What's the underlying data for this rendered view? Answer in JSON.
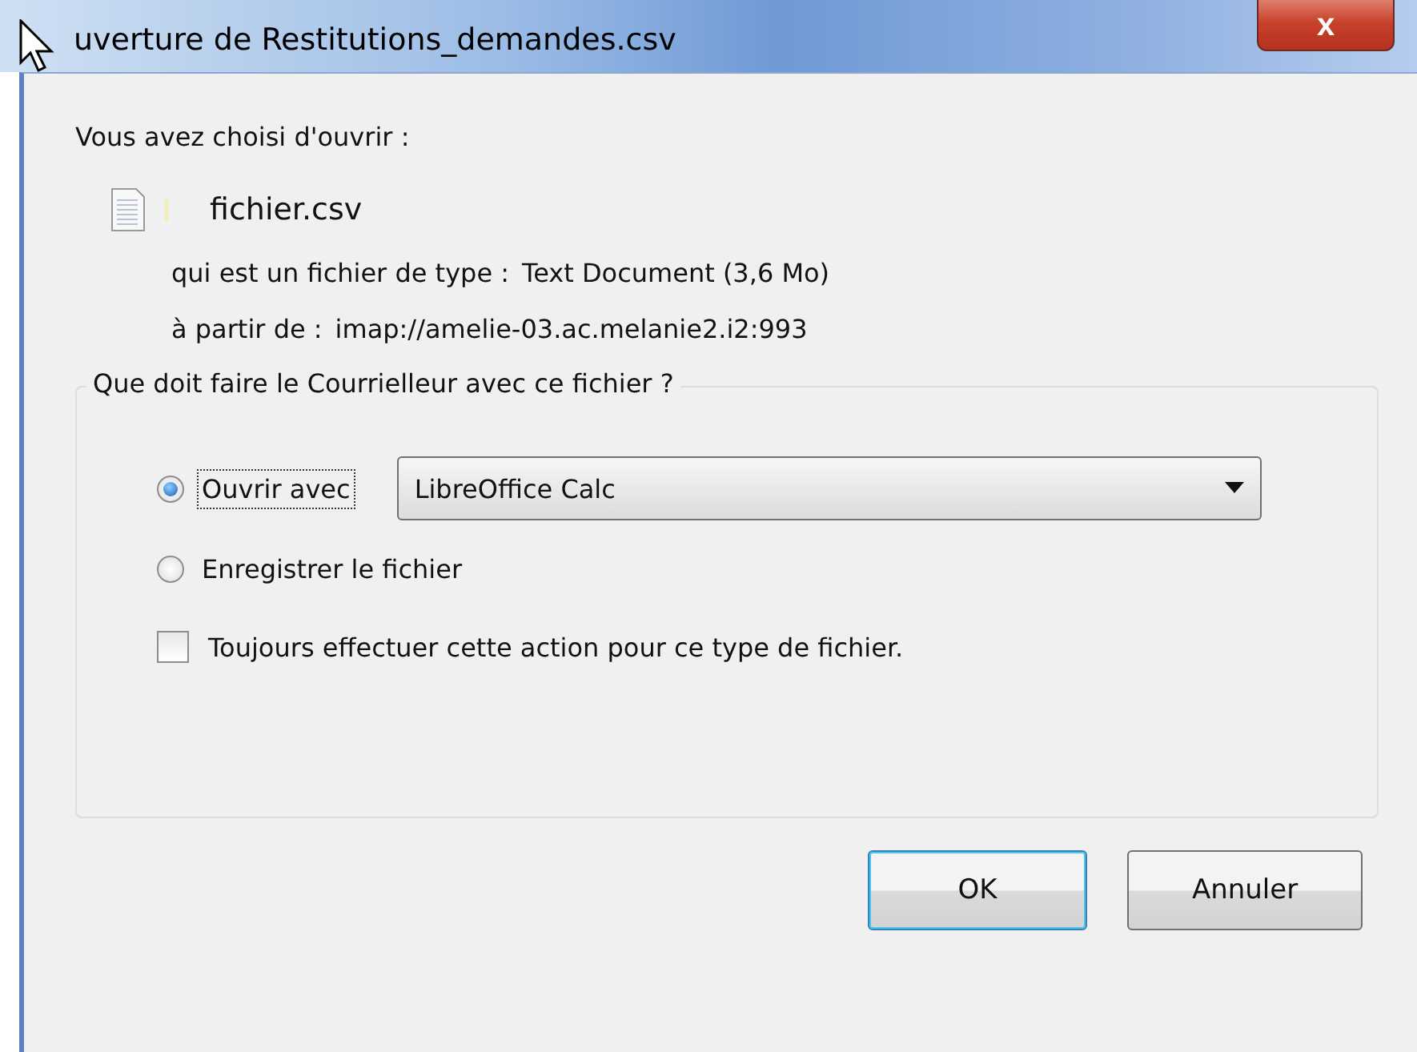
{
  "window": {
    "title": "uverture de Restitutions_demandes.csv",
    "close_label": "x"
  },
  "intro": "Vous avez choisi d'ouvrir :",
  "file": {
    "name": "fichier.csv",
    "type_label": "qui est un fichier de type :",
    "type_value": "Text Document (3,6 Mo)",
    "from_label": "à partir de :",
    "from_value": "imap://amelie-03.ac.melanie2.i2:993"
  },
  "group": {
    "title": "Que doit faire le Courrielleur avec ce fichier ?",
    "options": [
      {
        "label": "Ouvrir avec",
        "selected": true,
        "focused": true
      },
      {
        "label": "Enregistrer le fichier",
        "selected": false,
        "focused": false
      }
    ],
    "app_select": {
      "value": "LibreOffice Calc"
    },
    "always": {
      "label": "Toujours effectuer cette action pour ce type de fichier.",
      "checked": false
    }
  },
  "buttons": [
    {
      "label": "OK",
      "default": true
    },
    {
      "label": "Annuler",
      "default": false
    }
  ]
}
